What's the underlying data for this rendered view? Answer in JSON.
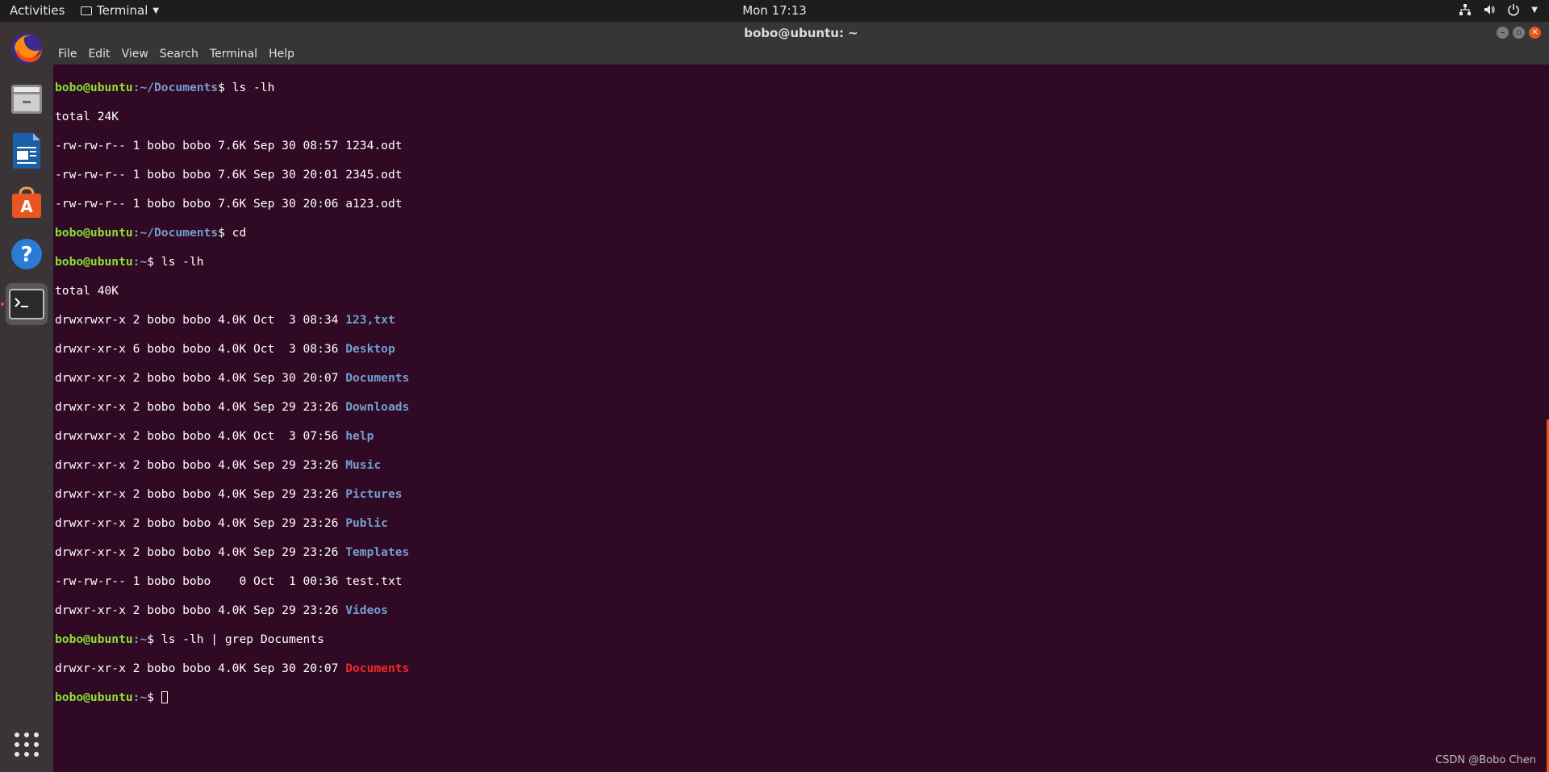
{
  "topbar": {
    "activities": "Activities",
    "app_name": "Terminal",
    "clock": "Mon 17:13"
  },
  "window": {
    "title": "bobo@ubuntu: ~"
  },
  "menu": [
    "File",
    "Edit",
    "View",
    "Search",
    "Terminal",
    "Help"
  ],
  "dock": [
    "firefox-icon",
    "files-icon",
    "writer-icon",
    "software-icon",
    "help-icon",
    "terminal-icon",
    "show-apps-icon"
  ],
  "terminal": {
    "user": "bobo@ubuntu",
    "p1_path": ":~/Documents",
    "p1_cmd": "$ ls -lh",
    "total1": "total 24K",
    "files1": [
      "-rw-rw-r-- 1 bobo bobo 7.6K Sep 30 08:57 1234.odt",
      "-rw-rw-r-- 1 bobo bobo 7.6K Sep 30 20:01 2345.odt",
      "-rw-rw-r-- 1 bobo bobo 7.6K Sep 30 20:06 a123.odt"
    ],
    "p2_path": ":~/Documents",
    "p2_cmd": "$ cd",
    "p3_path": ":~",
    "p3_cmd": "$ ls -lh",
    "total2": "total 40K",
    "entries": [
      {
        "meta": "drwxrwxr-x 2 bobo bobo 4.0K Oct  3 08:34 ",
        "name": "123,txt",
        "dir": true
      },
      {
        "meta": "drwxr-xr-x 6 bobo bobo 4.0K Oct  3 08:36 ",
        "name": "Desktop",
        "dir": true
      },
      {
        "meta": "drwxr-xr-x 2 bobo bobo 4.0K Sep 30 20:07 ",
        "name": "Documents",
        "dir": true
      },
      {
        "meta": "drwxr-xr-x 2 bobo bobo 4.0K Sep 29 23:26 ",
        "name": "Downloads",
        "dir": true
      },
      {
        "meta": "drwxrwxr-x 2 bobo bobo 4.0K Oct  3 07:56 ",
        "name": "help",
        "dir": true
      },
      {
        "meta": "drwxr-xr-x 2 bobo bobo 4.0K Sep 29 23:26 ",
        "name": "Music",
        "dir": true
      },
      {
        "meta": "drwxr-xr-x 2 bobo bobo 4.0K Sep 29 23:26 ",
        "name": "Pictures",
        "dir": true
      },
      {
        "meta": "drwxr-xr-x 2 bobo bobo 4.0K Sep 29 23:26 ",
        "name": "Public",
        "dir": true
      },
      {
        "meta": "drwxr-xr-x 2 bobo bobo 4.0K Sep 29 23:26 ",
        "name": "Templates",
        "dir": true
      },
      {
        "meta": "-rw-rw-r-- 1 bobo bobo    0 Oct  1 00:36 ",
        "name": "test.txt",
        "dir": false
      },
      {
        "meta": "drwxr-xr-x 2 bobo bobo 4.0K Sep 29 23:26 ",
        "name": "Videos",
        "dir": true
      }
    ],
    "p4_path": ":~",
    "p4_cmd": "$ ls -lh | grep Documents",
    "grep_meta": "drwxr-xr-x 2 bobo bobo 4.0K Sep 30 20:07 ",
    "grep_match": "Documents",
    "p5_path": ":~",
    "p5_cmd": "$ "
  },
  "watermark": "CSDN @Bobo Chen",
  "colors": {
    "terminal_bg": "#300a24",
    "prompt_user": "#8ae234",
    "prompt_path": "#729fcf",
    "directory": "#729fcf",
    "grep_match": "#ef2929",
    "accent": "#e95420"
  }
}
